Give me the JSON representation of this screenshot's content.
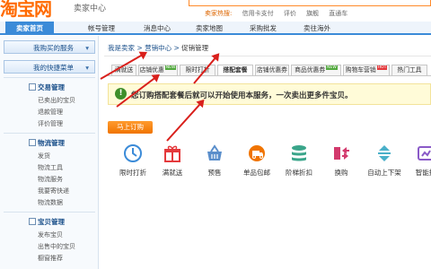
{
  "header": {
    "logo": "淘宝网",
    "subtitle": "卖家中心",
    "hot_label": "卖家热搜:",
    "hot_links": [
      "信用卡支付",
      "评价",
      "旗舰",
      "直通车"
    ]
  },
  "nav": {
    "items": [
      "卖家首页",
      "帐号管理",
      "消息中心",
      "卖家地图",
      "采购批发",
      "卖往海外"
    ]
  },
  "sidebar": {
    "buttons": [
      "我购买的服务",
      "我的快捷菜单"
    ],
    "groups": [
      {
        "title": "交易管理",
        "items": [
          "已卖出的宝贝",
          "退款管理",
          "评价管理"
        ]
      },
      {
        "title": "物流管理",
        "items": [
          "发货",
          "物流工具",
          "物流服务",
          "我要寄快递",
          "物流数据"
        ]
      },
      {
        "title": "宝贝管理",
        "items": [
          "发布宝贝",
          "出售中的宝贝",
          "橱窗推荐"
        ]
      }
    ]
  },
  "breadcrumb": {
    "home": "我是卖家",
    "mid": "营销中心",
    "current": "促销管理",
    "sep": ">"
  },
  "tabs": [
    {
      "label": "满就送",
      "badge": ""
    },
    {
      "label": "店铺优惠",
      "badge": "NEW",
      "badge_color": "green"
    },
    {
      "label": "限时打折",
      "badge": ""
    },
    {
      "label": "搭配套餐",
      "badge": ""
    },
    {
      "label": "店铺优惠券",
      "badge": ""
    },
    {
      "label": "商品优惠券",
      "badge": "NEW",
      "badge_color": "green"
    },
    {
      "label": "购物车营销",
      "badge": "HOT",
      "badge_color": "red"
    },
    {
      "label": "热门工具",
      "badge": ""
    }
  ],
  "notice": {
    "icon": "!",
    "text": "您订购搭配套餐后就可以开始使用本服务，一次卖出更多件宝贝。"
  },
  "order_button": "马上订购",
  "services": [
    {
      "label": "限时打折",
      "icon": "clock-icon"
    },
    {
      "label": "满就送",
      "icon": "gift-icon"
    },
    {
      "label": "预售",
      "icon": "basket-icon"
    },
    {
      "label": "单品包邮",
      "icon": "free-shipping-icon"
    },
    {
      "label": "阶梯折扣",
      "icon": "stack-icon"
    },
    {
      "label": "换购",
      "icon": "exchange-icon"
    },
    {
      "label": "自动上下架",
      "icon": "up-down-icon"
    },
    {
      "label": "智能推",
      "icon": "smart-icon"
    }
  ],
  "colors": {
    "accent": "#3b8bd8",
    "orange": "#f07400",
    "arrow": "#d9201c",
    "notice_bg": "#fffbd8"
  }
}
